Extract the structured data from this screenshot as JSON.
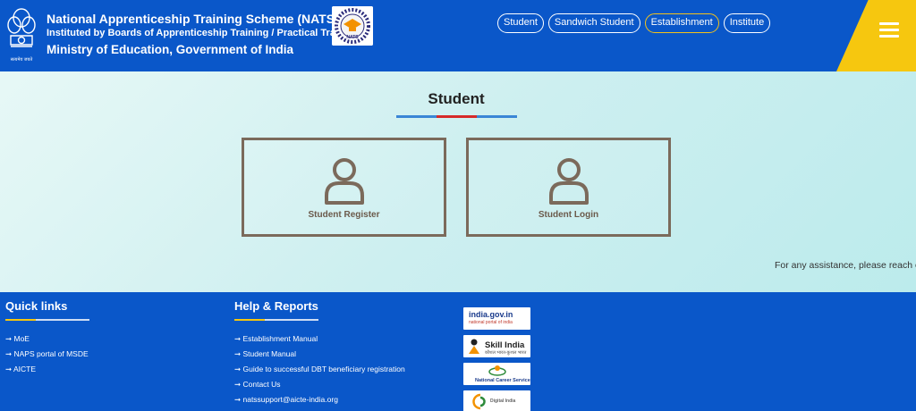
{
  "header": {
    "title_line1": "National Apprenticeship Training Scheme (NATS)",
    "title_line2": "Instituted by Boards of Apprenticeship Training / Practical Training",
    "title_line3": "Ministry of Education, Government of India",
    "emblem_caption": "सत्यमेव जयते",
    "nats_logo_text": "NATS"
  },
  "nav": {
    "items": [
      {
        "label": "Student"
      },
      {
        "label": "Sandwich Student"
      },
      {
        "label": "Establishment",
        "active": true
      },
      {
        "label": "Institute"
      }
    ]
  },
  "main": {
    "title": "Student",
    "cards": [
      {
        "label": "Student Register"
      },
      {
        "label": "Student Login"
      }
    ],
    "assistance_text": "For any assistance, please reach o"
  },
  "footer": {
    "quick_links": {
      "title": "Quick links",
      "items": [
        "➞ MoE",
        "➞ NAPS portal of MSDE",
        "➞ AICTE"
      ]
    },
    "help_reports": {
      "title": "Help & Reports",
      "items": [
        "➞ Establishment Manual",
        "➞ Student Manual",
        "➞ Guide to successful DBT beneficiary registration",
        "➞ Contact Us",
        "➞ natssupport@aicte-india.org"
      ]
    },
    "partners": [
      {
        "name": "india.gov.in",
        "sub": "national portal of india"
      },
      {
        "name": "Skill India",
        "sub": "कौशल भारत-कुशल भारत"
      },
      {
        "name": "National Career Service"
      },
      {
        "name": "Digital India"
      }
    ]
  },
  "colors": {
    "header_blue": "#0a57c9",
    "accent_yellow": "#f6c70f",
    "card_border": "#7b6a5b"
  }
}
